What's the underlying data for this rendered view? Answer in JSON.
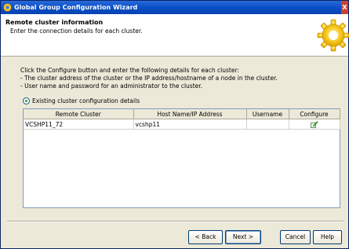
{
  "window": {
    "title": "Global Group Configuration Wizard",
    "close_glyph": "X"
  },
  "header": {
    "heading": "Remote cluster information",
    "subheading": "Enter the connection details for each cluster."
  },
  "instructions": {
    "line1": "Click the Configure button and enter the following details for each cluster:",
    "line2": "- The cluster address of the cluster or the IP address/hostname of a node in the cluster.",
    "line3": "- User name and password for an administrator to the cluster."
  },
  "radio": {
    "label": "Existing cluster configuration details"
  },
  "table": {
    "columns": [
      "Remote Cluster",
      "Host Name/IP Address",
      "Username",
      "Configure"
    ],
    "rows": [
      {
        "remote_cluster": "VCSHP11_72",
        "host": "vcshp11",
        "username": ""
      }
    ]
  },
  "buttons": {
    "back": "< Back",
    "next": "Next >",
    "cancel": "Cancel",
    "help": "Help"
  },
  "colors": {
    "titlebar": "#0a4fc9",
    "dialog_bg": "#ece9d8",
    "accent_gear": "#f5c518"
  },
  "icons": {
    "app": "globe-app-icon",
    "header": "gear-icon",
    "configure": "edit-configure-icon"
  }
}
